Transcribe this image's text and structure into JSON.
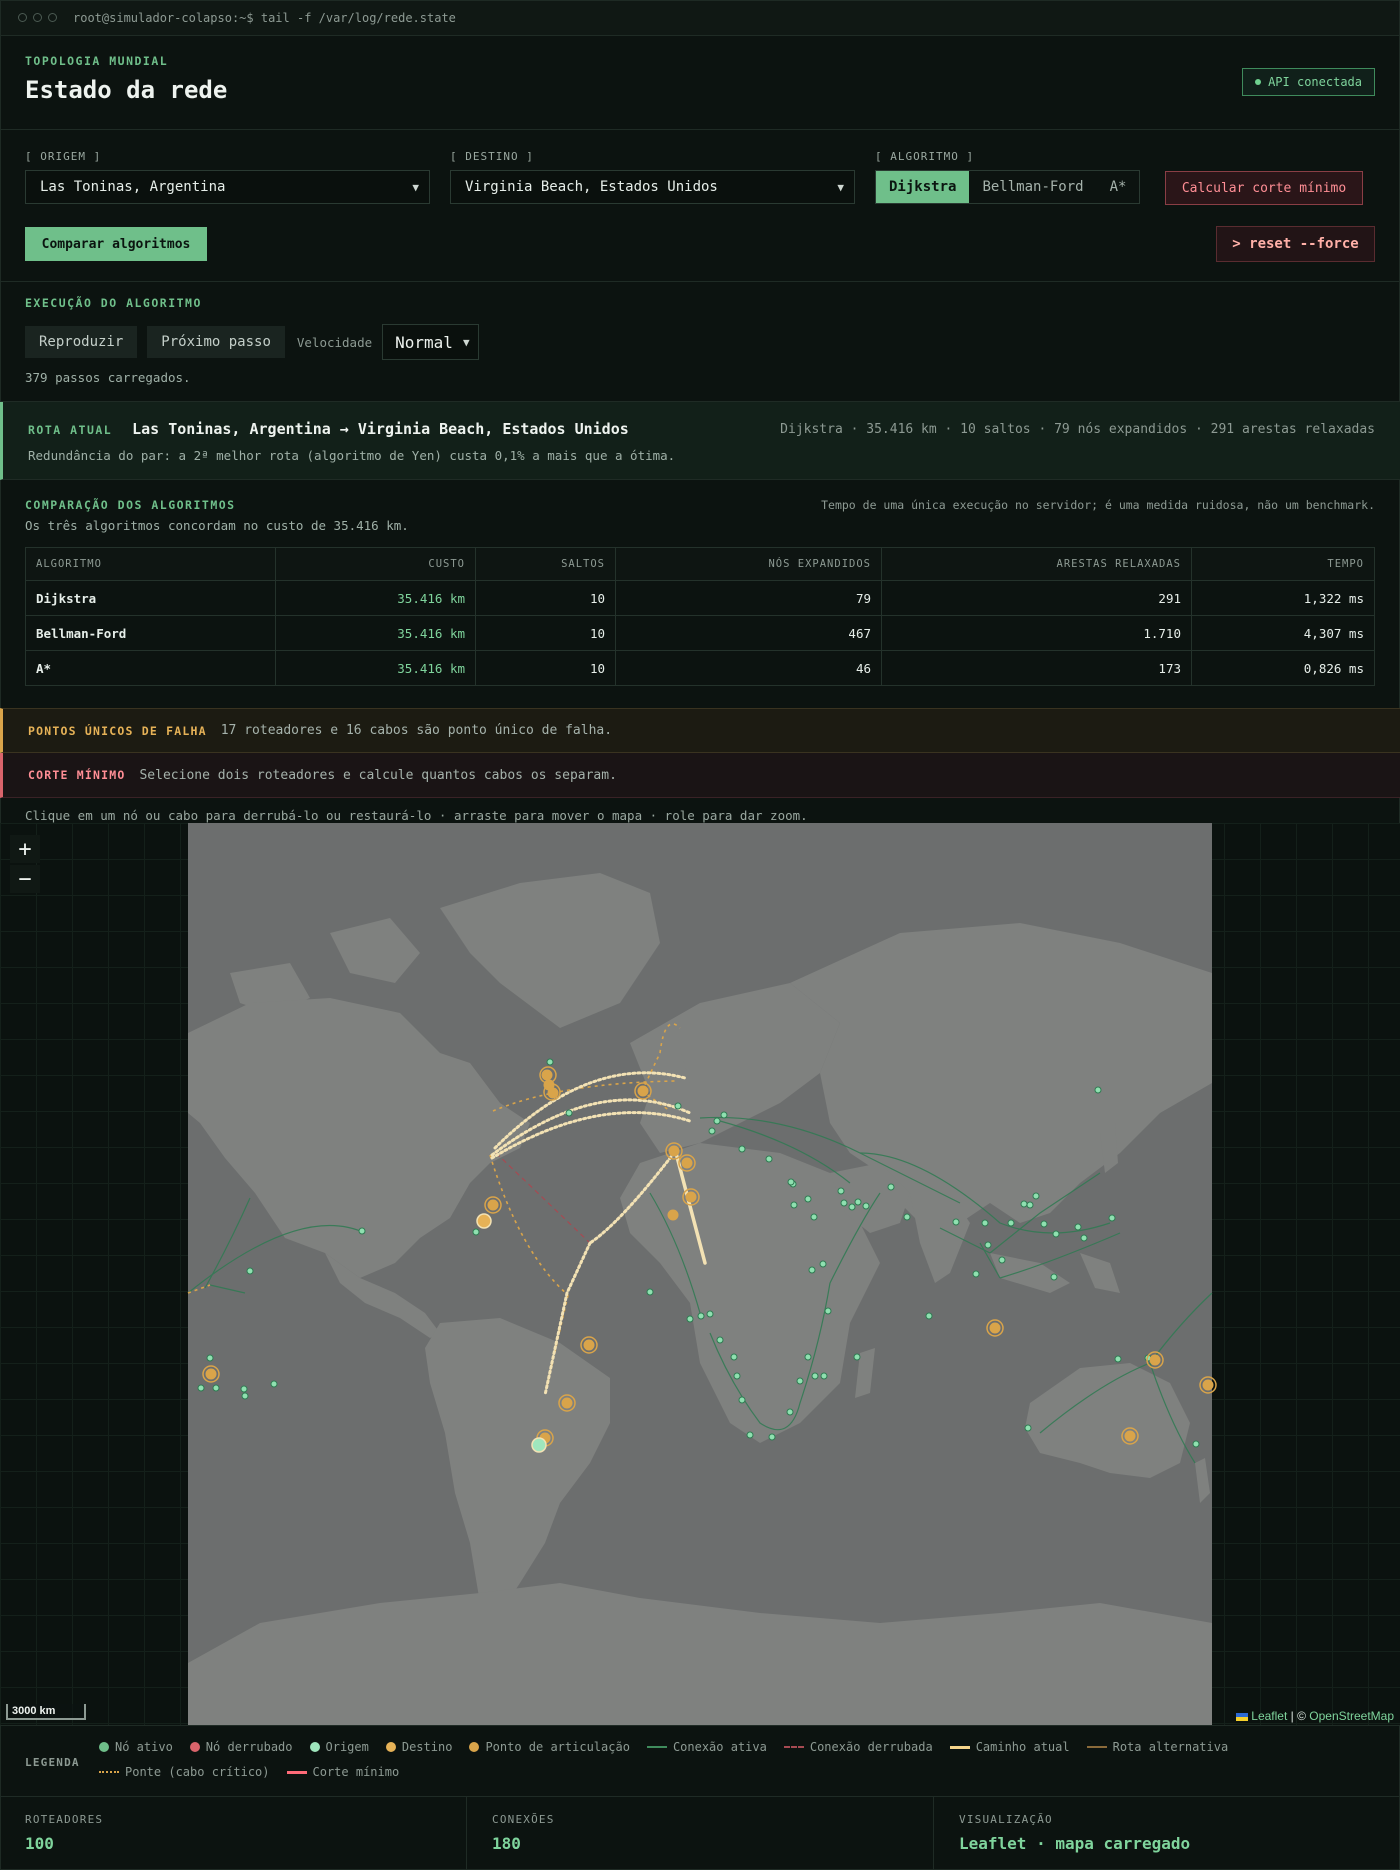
{
  "window": {
    "command": "root@simulador-colapso:~$ tail -f /var/log/rede.state"
  },
  "header": {
    "eyebrow": "TOPOLOGIA MUNDIAL",
    "title": "Estado da rede",
    "api_status": "API conectada"
  },
  "controls": {
    "origin_label": "[ ORIGEM ]",
    "origin_value": "Las Toninas, Argentina",
    "destination_label": "[ DESTINO ]",
    "destination_value": "Virginia Beach, Estados Unidos",
    "algorithm_label": "[ ALGORITMO ]",
    "algorithms": [
      "Dijkstra",
      "Bellman-Ford",
      "A*"
    ],
    "selected_algorithm": "Dijkstra",
    "min_cut_button": "Calcular corte mínimo",
    "compare_button": "Comparar algoritmos",
    "reset_button": "> reset --force"
  },
  "execution": {
    "title": "EXECUÇÃO DO ALGORITMO",
    "play_button": "Reproduzir",
    "next_button": "Próximo passo",
    "speed_label": "Velocidade",
    "speed_value": "Normal",
    "steps_text": "379 passos carregados."
  },
  "route": {
    "tag": "ROTA ATUAL",
    "title": "Las Toninas, Argentina → Virginia Beach, Estados Unidos",
    "meta": "Dijkstra · 35.416 km · 10 saltos · 79 nós expandidos · 291 arestas relaxadas",
    "redundancy": "Redundância do par: a 2ª melhor rota (algoritmo de Yen) custa 0,1% a mais que a ótima."
  },
  "comparison": {
    "title": "COMPARAÇÃO DOS ALGORITMOS",
    "note": "Tempo de uma única execução no servidor; é uma medida ruidosa, não um benchmark.",
    "summary": "Os três algoritmos concordam no custo de 35.416 km.",
    "columns": [
      "ALGORITMO",
      "CUSTO",
      "SALTOS",
      "NÓS EXPANDIDOS",
      "ARESTAS RELAXADAS",
      "TEMPO"
    ],
    "rows": [
      [
        "Dijkstra",
        "35.416 km",
        "10",
        "79",
        "291",
        "1,322 ms"
      ],
      [
        "Bellman-Ford",
        "35.416 km",
        "10",
        "467",
        "1.710",
        "4,307 ms"
      ],
      [
        "A*",
        "35.416 km",
        "10",
        "46",
        "173",
        "0,826 ms"
      ]
    ]
  },
  "alerts": {
    "spof_tag": "PONTOS ÚNICOS DE FALHA",
    "spof_text": "17 roteadores e 16 cabos são ponto único de falha.",
    "mincut_tag": "CORTE MÍNIMO",
    "mincut_text": "Selecione dois roteadores e calcule quantos cabos os separam."
  },
  "map": {
    "hint": "Clique em um nó ou cabo para derrubá-lo ou restaurá-lo · arraste para mover o mapa · role para dar zoom.",
    "zoom_in": "+",
    "zoom_out": "−",
    "scale": "3000 km",
    "attribution_leaflet": "Leaflet",
    "attribution_sep": " | © ",
    "attribution_osm": "OpenStreetMap",
    "colors": {
      "ocean": "#6c6e6e",
      "land": "#7f817f",
      "edge": "#2f7a52",
      "node": "#8fe0b0",
      "articulation": "#d9a44a",
      "path": "#f3e2b4"
    }
  },
  "legend": {
    "title": "LEGENDA",
    "items": [
      {
        "label": "Nó ativo",
        "kind": "dot",
        "color": "#6fbf8a"
      },
      {
        "label": "Nó derrubado",
        "kind": "dot",
        "color": "#d9646b"
      },
      {
        "label": "Origem",
        "kind": "dot",
        "color": "#9fe6bd"
      },
      {
        "label": "Destino",
        "kind": "dot",
        "color": "#e6b257"
      },
      {
        "label": "Ponto de articulação",
        "kind": "dot",
        "color": "#d9a44a"
      },
      {
        "label": "Conexão ativa",
        "kind": "line",
        "color": "#3f8b5c"
      },
      {
        "label": "Conexão derrubada",
        "kind": "dash",
        "color": "#a64a52"
      },
      {
        "label": "Caminho atual",
        "kind": "thick",
        "color": "#f5d48a"
      },
      {
        "label": "Rota alternativa",
        "kind": "line",
        "color": "#8a6a3a"
      },
      {
        "label": "Ponte (cabo crítico)",
        "kind": "dots",
        "color": "#d9a44a"
      },
      {
        "label": "Corte mínimo",
        "kind": "thick",
        "color": "#ff6b78"
      }
    ]
  },
  "stats": [
    {
      "label": "ROTEADORES",
      "value": "100"
    },
    {
      "label": "CONEXÕES",
      "value": "180"
    },
    {
      "label": "VISUALIZAÇÃO",
      "value": "Leaflet · mapa carregado"
    }
  ]
}
